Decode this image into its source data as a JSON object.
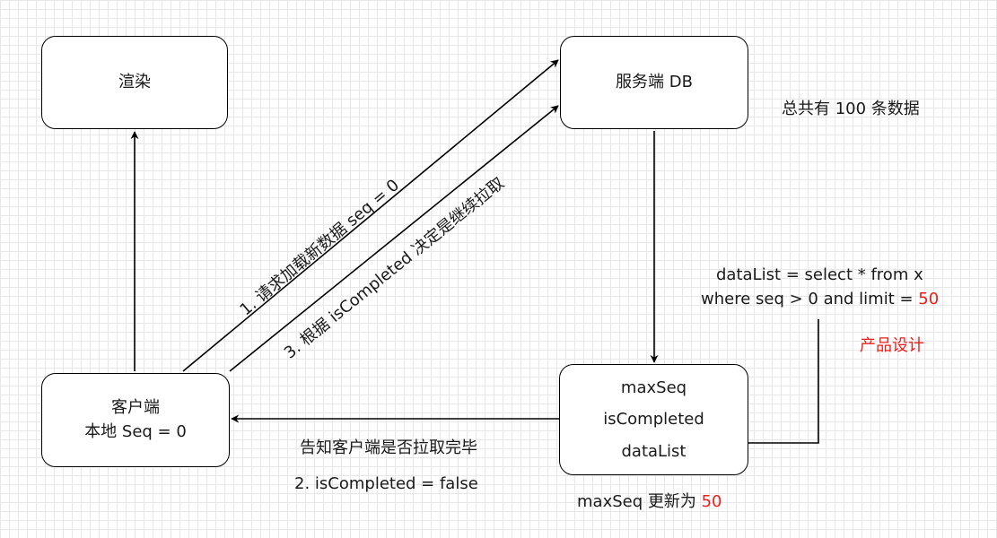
{
  "nodes": {
    "render": "渲染",
    "server": "服务端 DB",
    "client_line1": "客户端",
    "client_line2": "本地 Seq = 0",
    "result_line1": "maxSeq",
    "result_line2": "isCompleted",
    "result_line3": "dataList"
  },
  "labels": {
    "total": "总共有 100 条数据",
    "request": "1. 请求加载新数据 seq = 0",
    "decide": "3. 根据 isCompleted 决定是继续拉取",
    "query_line1": "dataList = select * from x",
    "query_line2_prefix": "where seq > 0 and limit = ",
    "query_limit": "50",
    "product": "产品设计",
    "notify": "告知客户端是否拉取完毕",
    "completed": "2. isCompleted = false",
    "maxseq_prefix": "maxSeq 更新为 ",
    "maxseq_value": "50"
  },
  "colors": {
    "highlight": "#e8201c",
    "stroke": "#000000",
    "grid": "#e7e7e7"
  }
}
